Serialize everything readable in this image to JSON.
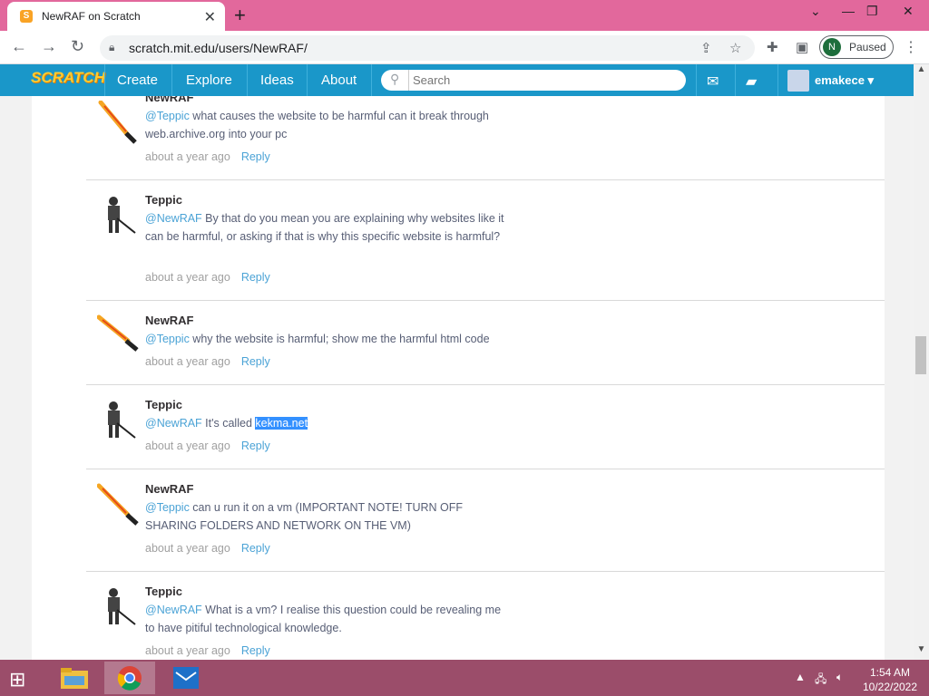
{
  "browser": {
    "tab_title": "NewRAF on Scratch",
    "tab_close": "✕",
    "new_tab": "+",
    "url": "scratch.mit.edu/users/NewRAF/",
    "profile_initial": "N",
    "profile_status": "Paused",
    "window_controls": [
      "⌄",
      "—",
      "❐",
      "✕"
    ]
  },
  "scratch_nav": {
    "logo": "SCRATCH",
    "links": [
      "Create",
      "Explore",
      "Ideas",
      "About"
    ],
    "search_placeholder": "Search",
    "username": "emakece ▾"
  },
  "comments": [
    {
      "author": "NewRAF",
      "mention": "@Teppic",
      "text": " what causes the website to be harmful can it break through web.archive.org into your pc",
      "time": "about a year ago",
      "reply": "Reply",
      "avatar": "lightsaber"
    },
    {
      "author": "Teppic",
      "mention": "@NewRAF",
      "text": " By that do you mean you are explaining why websites like it can be harmful, or asking if that is why this specific website is harmful?",
      "time": "about a year ago",
      "reply": "Reply",
      "avatar": "knight"
    },
    {
      "author": "NewRAF",
      "mention": "@Teppic",
      "text": " why the website is harmful; show me the harmful html code",
      "time": "about a year ago",
      "reply": "Reply",
      "avatar": "lightsaber"
    },
    {
      "author": "Teppic",
      "mention": "@NewRAF",
      "text": " It's called ",
      "highlight": "kekma.net",
      "time": "about a year ago",
      "reply": "Reply",
      "avatar": "knight"
    },
    {
      "author": "NewRAF",
      "mention": "@Teppic",
      "text": " can u run it on a vm (IMPORTANT NOTE! TURN OFF SHARING FOLDERS AND NETWORK ON THE VM)",
      "time": "about a year ago",
      "reply": "Reply",
      "avatar": "lightsaber"
    },
    {
      "author": "Teppic",
      "mention": "@NewRAF",
      "text": " What is a vm? I realise this question could be revealing me to have pitiful technological knowledge.",
      "time": "about a year ago",
      "reply": "Reply",
      "avatar": "knight"
    }
  ],
  "taskbar": {
    "time": "1:54 AM",
    "date": "10/22/2022"
  },
  "colors": {
    "tabstrip": "#e2689c",
    "scratch_blue": "#1a97c9",
    "link": "#4ba3d6",
    "selection": "#3390ff",
    "taskbar": "#9b4d6a"
  }
}
